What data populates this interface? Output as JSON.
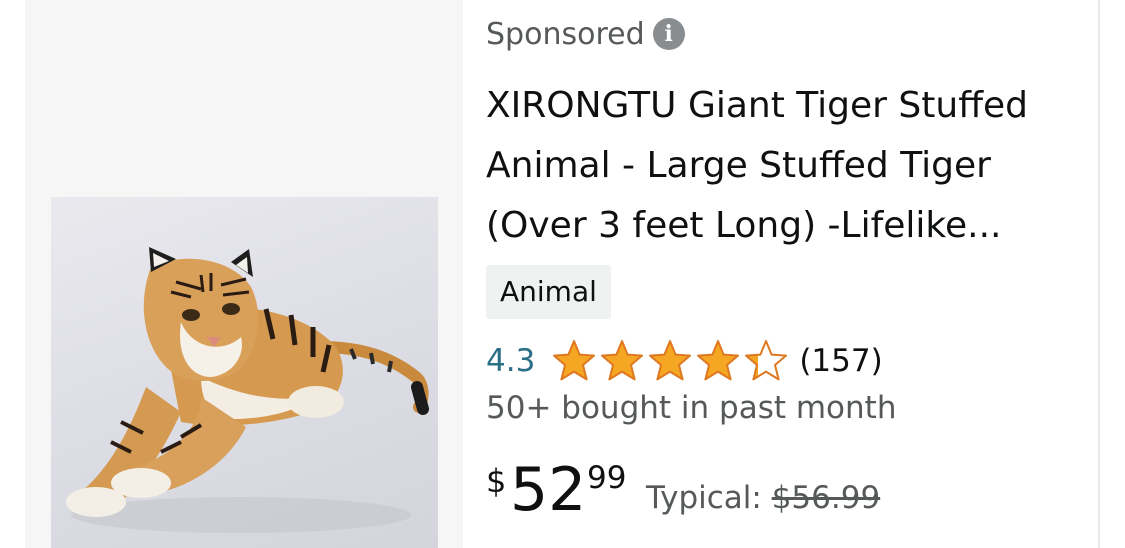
{
  "listing": {
    "sponsored_label": "Sponsored",
    "info_icon": "info-icon",
    "title_lines": [
      "XIRONGTU Giant Tiger Stuffed",
      "Animal - Large Stuffed Tiger",
      "(Over 3 feet Long) -Lifelike..."
    ],
    "badge": "Animal",
    "rating": {
      "value": "4.3",
      "stars_filled": 4.3,
      "stars_max": 5,
      "count": "(157)"
    },
    "bought_text": "50+ bought in past month",
    "price": {
      "symbol": "$",
      "whole": "52",
      "fraction": "99",
      "typical_label": "Typical:",
      "typical_price": "$56.99"
    }
  },
  "colors": {
    "star": "#f5a623",
    "rating_link": "#2a6f86",
    "muted_text": "#565959",
    "badge_bg": "#f0f2f2",
    "image_panel_bg": "#f6f6f6"
  }
}
